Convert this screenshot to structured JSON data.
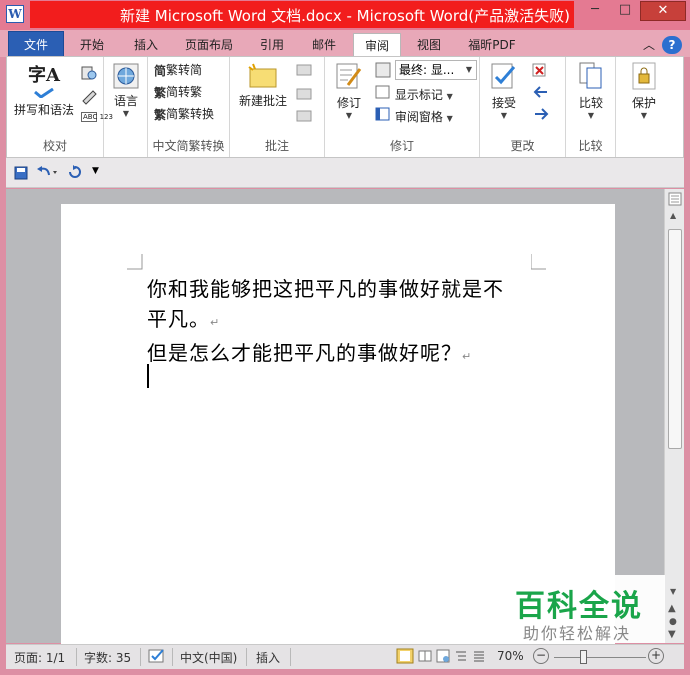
{
  "window": {
    "title": "新建 Microsoft Word 文档.docx - Microsoft Word(产品激活失败)",
    "app_icon": "W",
    "min_glyph": "─",
    "max_glyph": "□",
    "close_glyph": "✕"
  },
  "tabs": [
    {
      "label": "文件"
    },
    {
      "label": "开始"
    },
    {
      "label": "插入"
    },
    {
      "label": "页面布局"
    },
    {
      "label": "引用"
    },
    {
      "label": "邮件"
    },
    {
      "label": "审阅"
    },
    {
      "label": "视图"
    },
    {
      "label": "福昕PDF"
    }
  ],
  "tab_right": {
    "collapse": "︿",
    "help": "?"
  },
  "ribbon": {
    "groups": {
      "proofing": "校对",
      "language": "",
      "chinese_conversion": "中文简繁转换",
      "comments": "批注",
      "tracking": "修订",
      "changes": "更改",
      "compare": "比较"
    },
    "spelling_label": "拼写和语法",
    "spelling_icon_text": "字A",
    "language_label": "语言",
    "to_traditional": "繁转简",
    "to_simplified": "简转繁",
    "conversion": "简繁转换",
    "new_comment": "新建批注",
    "track_changes": "修订",
    "final_display": "最终: 显...",
    "show_markup": "显示标记",
    "reviewing_pane": "审阅窗格",
    "accept": "接受",
    "compare_label": "比较",
    "protect_label": "保护",
    "abc_label": "ABC 123"
  },
  "document": {
    "line1": "你和我能够把这把平凡的事做好就是不",
    "line2": "平凡。",
    "line3": "但是怎么才能把平凡的事做好呢？",
    "para_mark": "↵"
  },
  "status": {
    "page": "页面: 1/1",
    "words": "字数: 35",
    "language": "中文(中国)",
    "mode": "插入",
    "zoom": "70%",
    "zoom_out": "−",
    "zoom_in": "+"
  },
  "watermark": {
    "title": "百科全说",
    "subtitle": "助你轻松解决"
  }
}
